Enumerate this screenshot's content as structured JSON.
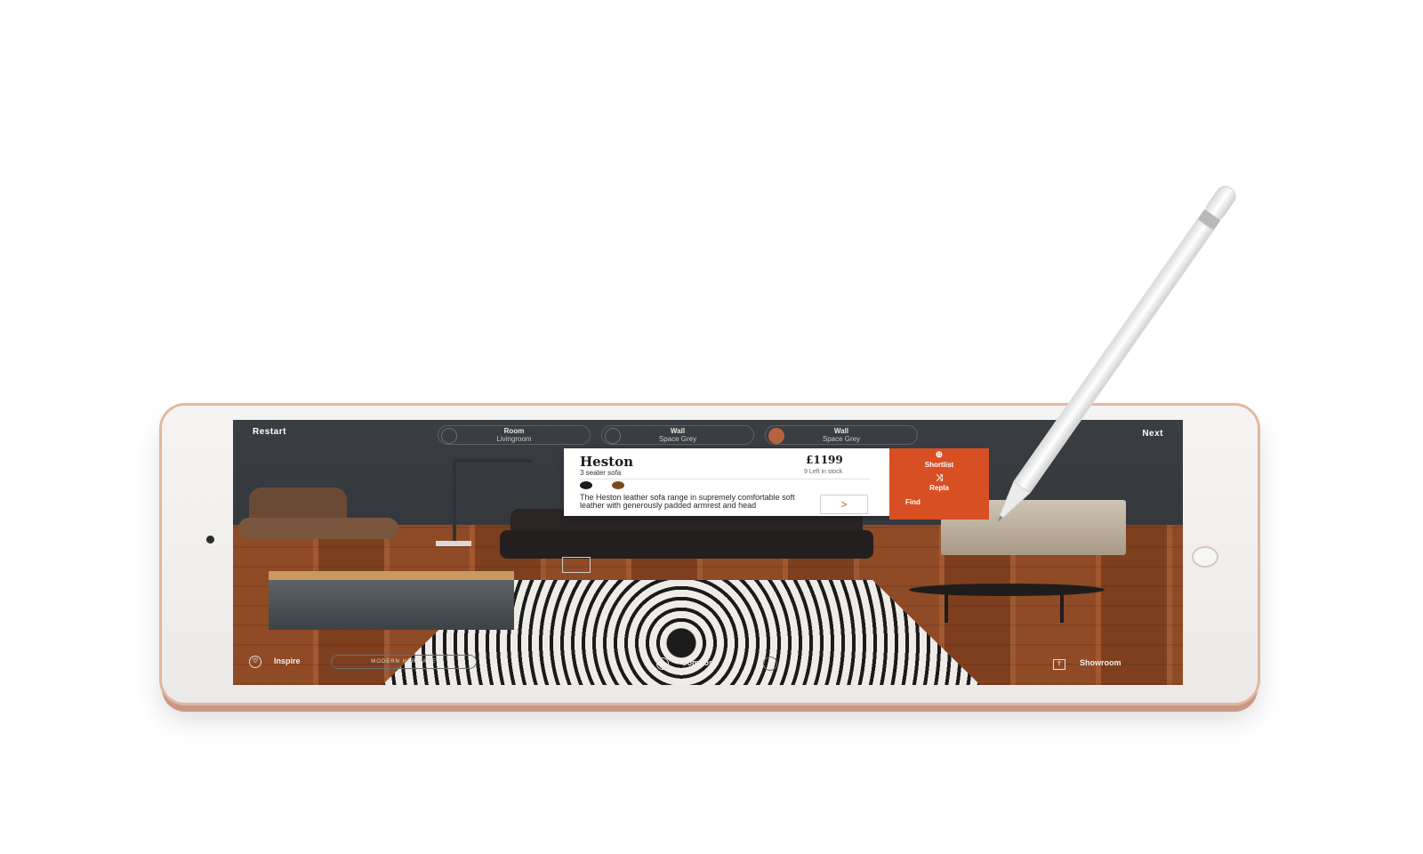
{
  "topbar": {
    "restart": "Restart",
    "next": "Next",
    "selectors": [
      {
        "label": "Room",
        "value": "Livingroom"
      },
      {
        "label": "Wall",
        "value": "Space Grey"
      },
      {
        "label": "Wall",
        "value": "Space Grey"
      }
    ]
  },
  "product": {
    "name": "Heston",
    "subtitle": "3 seater sofa",
    "price": "£1199",
    "stock": "9 Left in stock",
    "description": "The Heston leather sofa range in supremely comfortable soft leather with generously padded armrest and head",
    "swatches": [
      "#1c1c1c",
      "#7b4a1c"
    ],
    "more": ">"
  },
  "actions": {
    "shortlist": "Shortlist",
    "replace": "Repla",
    "find": "Find"
  },
  "bottombar": {
    "inspire": "Inspire",
    "style": "MODERN HERITAGE",
    "compose": "Compose",
    "showroom": "Showroom"
  },
  "colors": {
    "accent": "#d84f24",
    "wall": "#3a3e43",
    "device_frame": "#e2b6a0"
  }
}
